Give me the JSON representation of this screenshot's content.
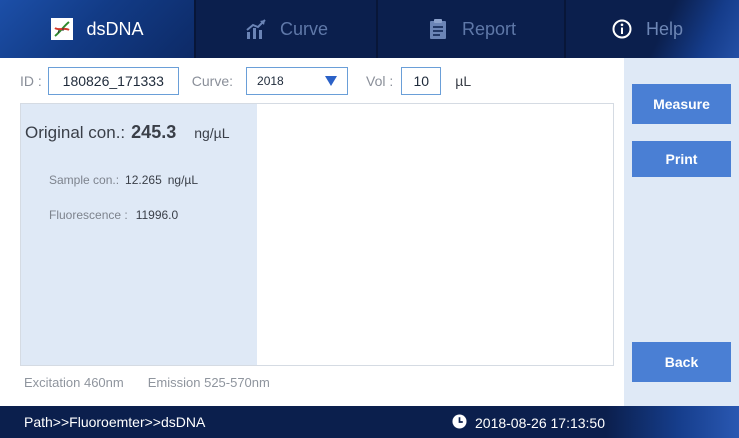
{
  "tabs": [
    {
      "label": "dsDNA",
      "icon": "dna-icon"
    },
    {
      "label": "Curve",
      "icon": "chart-icon"
    },
    {
      "label": "Report",
      "icon": "report-icon"
    },
    {
      "label": "Help",
      "icon": "info-icon"
    }
  ],
  "params": {
    "id_label": "ID :",
    "id_value": "180826_171333",
    "curve_label": "Curve:",
    "curve_value": "2018",
    "vol_label": "Vol :",
    "vol_value": "10",
    "vol_unit": "µL"
  },
  "result": {
    "original_label": "Original con.:",
    "original_value": "245.3",
    "original_unit": "ng/µL",
    "sample_label": "Sample con.:",
    "sample_value": "12.265",
    "sample_unit": "ng/µL",
    "fluorescence_label": "Fluorescence :",
    "fluorescence_value": "11996.0"
  },
  "info": {
    "excitation": "Excitation 460nm",
    "emission": "Emission 525-570nm"
  },
  "buttons": {
    "measure": "Measure",
    "print": "Print",
    "back": "Back"
  },
  "status": {
    "path": "Path>>Fluoroemter>>dsDNA",
    "datetime": "2018-08-26 17:13:50"
  },
  "colors": {
    "nav_bg": "#0b1f4d",
    "active_tab": "#1c4fa8",
    "button_bg": "#4a7fd4",
    "panel_bg": "#dfe9f6",
    "field_border": "#6a9fd8"
  }
}
